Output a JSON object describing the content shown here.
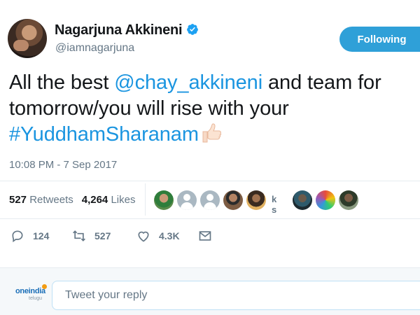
{
  "user": {
    "display_name": "Nagarjuna Akkineni",
    "handle": "@iamnagarjuna",
    "verified": true
  },
  "follow_button": {
    "label": "Following"
  },
  "tweet": {
    "text_1": "All the best ",
    "mention": "@chay_akkineni",
    "text_2": " and team for tomorrow/you will rise with your ",
    "hashtag": "#YuddhamSharanam",
    "emoji": "thumbs-up-icon",
    "timestamp": "10:08 PM - 7 Sep 2017"
  },
  "stats": {
    "retweets_count": "527",
    "retweets_label": "Retweets",
    "likes_count": "4,264",
    "likes_label": "Likes",
    "liker_text": "k s"
  },
  "actions": {
    "reply_count": "124",
    "retweet_count": "527",
    "like_count": "4.3K"
  },
  "reply": {
    "placeholder": "Tweet your reply",
    "logo_text": "oneindia",
    "logo_subtext": "telugu"
  },
  "colors": {
    "link": "#1b95e0",
    "follow_button": "#2fa0d8",
    "muted": "#657786"
  }
}
